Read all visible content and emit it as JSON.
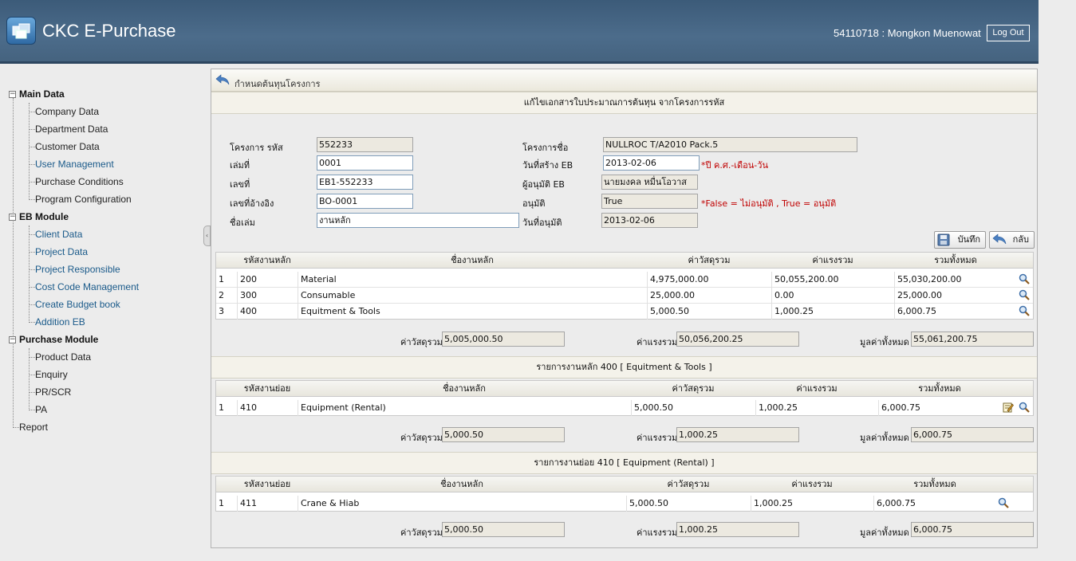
{
  "header": {
    "app_title": "CKC E-Purchase",
    "user": "54110718 : Mongkon Muenowat",
    "logout_label": "Log Out"
  },
  "sidebar": {
    "groups": [
      {
        "label": "Main Data",
        "items": [
          "Company Data",
          "Department Data",
          "Customer Data",
          "User Management",
          "Purchase Conditions",
          "Program Configuration"
        ]
      },
      {
        "label": "EB Module",
        "items": [
          "Client Data",
          "Project Data",
          "Project Responsible",
          "Cost Code Management",
          "Create Budget book",
          "Addition EB"
        ]
      },
      {
        "label": "Purchase Module",
        "items": [
          "Product Data",
          "Enquiry",
          "PR/SCR",
          "PA"
        ]
      }
    ],
    "report_label": "Report"
  },
  "panel": {
    "title": "กำหนดต้นทุนโครงการ",
    "section_title": "แก้ไขเอกสารใบประมาณการต้นทุน   จากโครงการรหัส",
    "form": {
      "project_code_label": "โครงการ รหัส",
      "project_code": "552233",
      "volume_label": "เล่มที่",
      "volume": "0001",
      "number_label": "เลขที่",
      "number": "EB1-552233",
      "ref_label": "เลขที่อ้างอิง",
      "ref": "BO-0001",
      "book_name_label": "ชื่อเล่ม",
      "book_name": "งานหลัก",
      "project_name_label": "โครงการชื่อ",
      "project_name": "NULLROC T/A2010 Pack.5",
      "created_date_label": "วันที่สร้าง EB",
      "created_date": "2013-02-06",
      "date_hint": "*ปี ค.ศ.-เดือน-วัน",
      "approver_label": "ผู้อนุมัติ EB",
      "approver": "นายมงคล หมื่นโอวาส",
      "approved_label": "อนุมัติ",
      "approved": "True",
      "approved_hint": "*False = ไม่อนุมัติ , True = อนุมัติ",
      "approved_date_label": "วันที่อนุมัติ",
      "approved_date": "2013-02-06"
    },
    "save_label": "บันทึก",
    "back_label": "กลับ"
  },
  "main_grid": {
    "headers": [
      "",
      "รหัสงานหลัก",
      "ชื่องานหลัก",
      "ค่าวัสดุรวม",
      "ค่าแรงรวม",
      "รวมทั้งหมด"
    ],
    "rows": [
      [
        "1",
        "200",
        "Material",
        "4,975,000.00",
        "50,055,200.00",
        "55,030,200.00"
      ],
      [
        "2",
        "300",
        "Consumable",
        "25,000.00",
        "0.00",
        "25,000.00"
      ],
      [
        "3",
        "400",
        "Equitment & Tools",
        "5,000.50",
        "1,000.25",
        "6,000.75"
      ]
    ],
    "totals": {
      "material_label": "ค่าวัสดุรวม",
      "material": "5,005,000.50",
      "labor_label": "ค่าแรงรวม",
      "labor": "50,056,200.25",
      "total_label": "มูลค่าทั้งหมด",
      "total": "55,061,200.75"
    }
  },
  "sub_section": {
    "title": "รายการงานหลัก 400 [ Equitment & Tools ]",
    "headers": [
      "",
      "รหัสงานย่อย",
      "ชื่องานหลัก",
      "ค่าวัสดุรวม",
      "ค่าแรงรวม",
      "รวมทั้งหมด"
    ],
    "rows": [
      [
        "1",
        "410",
        "Equipment (Rental)",
        "5,000.50",
        "1,000.25",
        "6,000.75"
      ]
    ],
    "totals": {
      "material_label": "ค่าวัสดุรวม",
      "material": "5,000.50",
      "labor_label": "ค่าแรงรวม",
      "labor": "1,000.25",
      "total_label": "มูลค่าทั้งหมด",
      "total": "6,000.75"
    }
  },
  "detail_section": {
    "title": "รายการงานย่อย 410 [ Equipment (Rental) ]",
    "headers": [
      "",
      "รหัสงานย่อย",
      "ชื่องานหลัก",
      "ค่าวัสดุรวม",
      "ค่าแรงรวม",
      "รวมทั้งหมด"
    ],
    "rows": [
      [
        "1",
        "411",
        "Crane & Hiab",
        "5,000.50",
        "1,000.25",
        "6,000.75"
      ]
    ],
    "totals": {
      "material_label": "ค่าวัสดุรวม",
      "material": "5,000.50",
      "labor_label": "ค่าแรงรวม",
      "labor": "1,000.25",
      "total_label": "มูลค่าทั้งหมด",
      "total": "6,000.75"
    }
  }
}
